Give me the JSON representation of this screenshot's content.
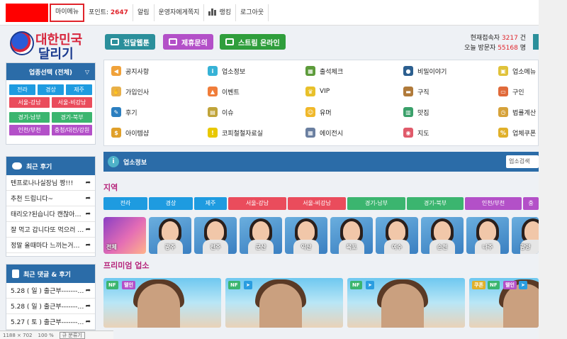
{
  "topnav": {
    "my_menu": "마이메뉴",
    "points_label": "포인트:",
    "points_value": "2647",
    "alarm": "알림",
    "admin_msg": "운영자에게쪽지",
    "ranking": "랭킹",
    "logout": "로그아웃"
  },
  "logo": {
    "line1": "대한민국",
    "line2": "달리기"
  },
  "header_buttons": {
    "webtoon": "전달웹툰",
    "partnership": "제휴문의",
    "stream": "스트림 온라인"
  },
  "counts": {
    "current_label": "현재접속자",
    "current_value": "3217",
    "current_unit": "건",
    "today_label": "오늘 방문자",
    "today_value": "55168",
    "today_unit": "명"
  },
  "sidebar": {
    "category_title": "업종선택 (전체)",
    "regions": [
      {
        "label": "전라",
        "color": "#1e9be0"
      },
      {
        "label": "경상",
        "color": "#1e9be0"
      },
      {
        "label": "제주",
        "color": "#1e9be0"
      },
      {
        "label": "서울-강남",
        "color": "#ea4c5c"
      },
      {
        "label": "서울-비강남",
        "color": "#ea4c5c"
      }
    ],
    "regions2": [
      {
        "label": "경기-남부",
        "color": "#3bb56f"
      },
      {
        "label": "경기-북부",
        "color": "#3bb56f"
      },
      {
        "label": "인천/부천",
        "color": "#b350c8"
      },
      {
        "label": "충청/대전/강원",
        "color": "#b350c8"
      }
    ],
    "reviews_title": "최근 후기",
    "reviews": [
      "텐프로나나실장님 짱!!!",
      "추천 드립니다~",
      "태리오?된습니다 캔찮아요...",
      "잘 먹고 갑니다또 먹으러 갈게...",
      "정말 올때마다 느끼는거지만..."
    ],
    "comments_title": "최근 댓글 & 후기",
    "comments": [
      "5.28 ( 일 ) 출근부---------------",
      "5.28 ( 일 ) 출근부---------------",
      "5.27 ( 토 ) 출근부---------------"
    ]
  },
  "menu": [
    {
      "label": "공지사항",
      "icon": "megaphone-icon",
      "color": "#f0a23a",
      "glyph": "◀"
    },
    {
      "label": "업소정보",
      "icon": "info-icon",
      "color": "#36b2d6",
      "glyph": "i"
    },
    {
      "label": "출석체크",
      "icon": "calendar-icon",
      "color": "#5d9b3b",
      "glyph": "▦"
    },
    {
      "label": "비밀이야기",
      "icon": "person-secret-icon",
      "color": "#2c5f8f",
      "glyph": "●"
    },
    {
      "label": "업소메뉴",
      "icon": "bag-icon",
      "color": "#e0c23a",
      "glyph": "▣"
    },
    {
      "label": "가입인사",
      "icon": "hand-icon",
      "color": "#e8b04a",
      "glyph": "✋"
    },
    {
      "label": "이벤트",
      "icon": "party-icon",
      "color": "#f07d3a",
      "glyph": "▲"
    },
    {
      "label": "VIP",
      "icon": "crown-icon",
      "color": "#e8c02a",
      "glyph": "♛"
    },
    {
      "label": "구직",
      "icon": "briefcase-icon",
      "color": "#b07a3a",
      "glyph": "▬"
    },
    {
      "label": "구인",
      "icon": "monitor-icon",
      "color": "#e06a3a",
      "glyph": "▭"
    },
    {
      "label": "후기",
      "icon": "review-icon",
      "color": "#2c7fc0",
      "glyph": "✎"
    },
    {
      "label": "이슈",
      "icon": "news-icon",
      "color": "#c0a43a",
      "glyph": "▤"
    },
    {
      "label": "유머",
      "icon": "laugh-icon",
      "color": "#f0b82a",
      "glyph": "☺"
    },
    {
      "label": "맛집",
      "icon": "store-icon",
      "color": "#3aa06a",
      "glyph": "▥"
    },
    {
      "label": "법률계산",
      "icon": "clock-icon",
      "color": "#d6a23a",
      "glyph": "◷"
    },
    {
      "label": "아이템샵",
      "icon": "coin-icon",
      "color": "#e0a02a",
      "glyph": "$"
    },
    {
      "label": "코피철철자료실",
      "icon": "warning-icon",
      "color": "#e8c800",
      "glyph": "!"
    },
    {
      "label": "에이전시",
      "icon": "agency-icon",
      "color": "#6a7fa0",
      "glyph": "▦"
    },
    {
      "label": "지도",
      "icon": "map-pin-icon",
      "color": "#e05a6a",
      "glyph": "◉"
    },
    {
      "label": "업체쿠폰",
      "icon": "coupon-icon",
      "color": "#e0b02a",
      "glyph": "%"
    }
  ],
  "info_bar": {
    "title": "업소정보",
    "select_placeholder": "업소검색"
  },
  "region_section": {
    "title": "지역",
    "tabs": [
      {
        "label": "전라",
        "color": "#1e9be0"
      },
      {
        "label": "경상",
        "color": "#1e9be0"
      },
      {
        "label": "제주",
        "color": "#1e9be0"
      },
      {
        "label": "서울-강남",
        "color": "#ea4c5c"
      },
      {
        "label": "서울-비강남",
        "color": "#ea4c5c"
      },
      {
        "label": "경기-남부",
        "color": "#3bb56f"
      },
      {
        "label": "경기-북부",
        "color": "#3bb56f"
      },
      {
        "label": "인천/부천",
        "color": "#b350c8"
      },
      {
        "label": "충",
        "color": "#b350c8"
      }
    ],
    "thumbs": [
      "전체",
      "광주",
      "전주",
      "군산",
      "익산",
      "목포",
      "여수",
      "순천",
      "나주",
      "광양"
    ]
  },
  "premium_section": {
    "title": "프리미엄 업소",
    "cards": [
      {
        "tags": [
          {
            "label": "NF",
            "color": "#3bb56f"
          },
          {
            "label": "텔인",
            "color": "#b350c8"
          }
        ]
      },
      {
        "tags": [
          {
            "label": "NF",
            "color": "#3bb56f"
          },
          {
            "label": "➤",
            "color": "#2a9de0"
          }
        ]
      },
      {
        "tags": [
          {
            "label": "NF",
            "color": "#3bb56f"
          },
          {
            "label": "➤",
            "color": "#2a9de0"
          }
        ]
      },
      {
        "tags": [
          {
            "label": "쿠폰",
            "color": "#e0b02a"
          },
          {
            "label": "NF",
            "color": "#3bb56f"
          },
          {
            "label": "텔인",
            "color": "#b350c8"
          },
          {
            "label": "➤",
            "color": "#2a9de0"
          }
        ]
      }
    ]
  },
  "statusbar": {
    "size": "1188 × 702",
    "zoom": "100 %",
    "button": "규 분류기"
  }
}
